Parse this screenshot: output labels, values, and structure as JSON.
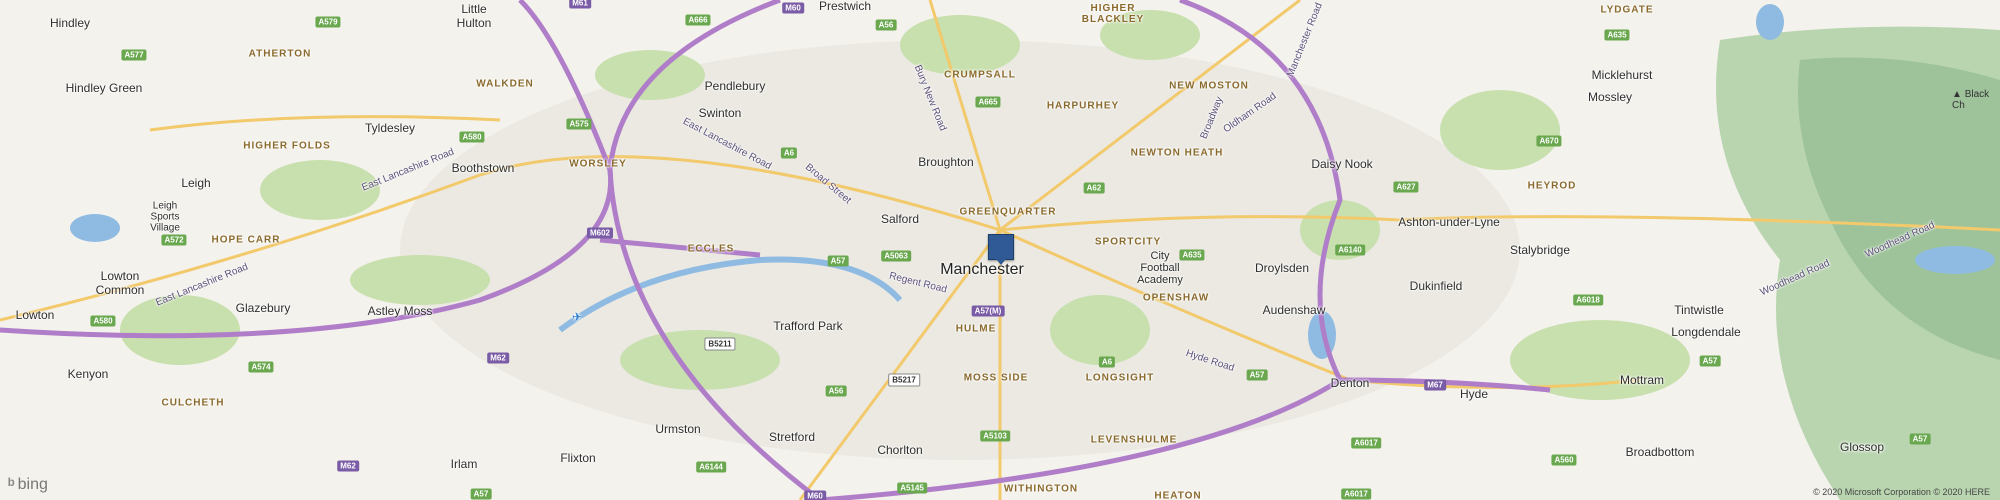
{
  "map": {
    "provider": "bing",
    "copyright": "© 2020 Microsoft Corporation © 2020 HERE",
    "center_label": "Manchester",
    "pin_icon": "location-pin-icon",
    "colors": {
      "motorway": "#b07ec9",
      "primary_road": "#f2c96b",
      "water": "#6fa8dc",
      "park": "#c8dfae",
      "urban": "#ecebe5",
      "hills": "#9cc49a",
      "pin": "#2f5a96"
    },
    "places": [
      {
        "id": "hindley",
        "name": "Hindley"
      },
      {
        "id": "little-hulton",
        "name": "Little\nHulton"
      },
      {
        "id": "hindley-green",
        "name": "Hindley Green"
      },
      {
        "id": "tyldesley",
        "name": "Tyldesley"
      },
      {
        "id": "boothstown",
        "name": "Boothstown"
      },
      {
        "id": "leigh",
        "name": "Leigh"
      },
      {
        "id": "leigh-sports-village",
        "name": "Leigh\nSports\nVillage"
      },
      {
        "id": "lowton-common",
        "name": "Lowton\nCommon"
      },
      {
        "id": "lowton",
        "name": "Lowton"
      },
      {
        "id": "glazebury",
        "name": "Glazebury"
      },
      {
        "id": "astley-moss",
        "name": "Astley Moss"
      },
      {
        "id": "kenyon",
        "name": "Kenyon"
      },
      {
        "id": "irlam",
        "name": "Irlam"
      },
      {
        "id": "flixton",
        "name": "Flixton"
      },
      {
        "id": "urmston",
        "name": "Urmston"
      },
      {
        "id": "stretford",
        "name": "Stretford"
      },
      {
        "id": "chorlton",
        "name": "Chorlton"
      },
      {
        "id": "trafford-park",
        "name": "Trafford Park"
      },
      {
        "id": "pendlebury",
        "name": "Pendlebury"
      },
      {
        "id": "swinton",
        "name": "Swinton"
      },
      {
        "id": "prestwich",
        "name": "Prestwich"
      },
      {
        "id": "broughton",
        "name": "Broughton"
      },
      {
        "id": "salford",
        "name": "Salford"
      },
      {
        "id": "manchester",
        "name": "Manchester"
      },
      {
        "id": "city-football-academy",
        "name": "City\nFootball\nAcademy"
      },
      {
        "id": "daisy-nook",
        "name": "Daisy Nook"
      },
      {
        "id": "droylsden",
        "name": "Droylsden"
      },
      {
        "id": "audenshaw",
        "name": "Audenshaw"
      },
      {
        "id": "denton",
        "name": "Denton"
      },
      {
        "id": "hyde",
        "name": "Hyde"
      },
      {
        "id": "dukinfield",
        "name": "Dukinfield"
      },
      {
        "id": "ashton-under-lyne",
        "name": "Ashton-under-Lyne"
      },
      {
        "id": "stalybridge",
        "name": "Stalybridge"
      },
      {
        "id": "mossley",
        "name": "Mossley"
      },
      {
        "id": "micklehurst",
        "name": "Micklehurst"
      },
      {
        "id": "tintwistle",
        "name": "Tintwistle"
      },
      {
        "id": "longdendale",
        "name": "Longdendale"
      },
      {
        "id": "mottram",
        "name": "Mottram"
      },
      {
        "id": "broadbottom",
        "name": "Broadbottom"
      },
      {
        "id": "glossop",
        "name": "Glossop"
      }
    ],
    "districts": [
      {
        "id": "atherton",
        "name": "ATHERTON"
      },
      {
        "id": "walkden",
        "name": "WALKDEN"
      },
      {
        "id": "higher-folds",
        "name": "HIGHER FOLDS"
      },
      {
        "id": "worsley",
        "name": "WORSLEY"
      },
      {
        "id": "hope-carr",
        "name": "HOPE CARR"
      },
      {
        "id": "eccles",
        "name": "ECCLES"
      },
      {
        "id": "culcheth",
        "name": "CULCHETH"
      },
      {
        "id": "crumpsall",
        "name": "CRUMPSALL"
      },
      {
        "id": "higher-blackley",
        "name": "HIGHER\nBLACKLEY"
      },
      {
        "id": "harpurhey",
        "name": "HARPURHEY"
      },
      {
        "id": "new-moston",
        "name": "NEW MOSTON"
      },
      {
        "id": "newton-heath",
        "name": "NEWTON HEATH"
      },
      {
        "id": "greenquarter",
        "name": "GREENQUARTER"
      },
      {
        "id": "sportcity",
        "name": "SPORTCITY"
      },
      {
        "id": "openshaw",
        "name": "OPENSHAW"
      },
      {
        "id": "hulme",
        "name": "HULME"
      },
      {
        "id": "moss-side",
        "name": "MOSS SIDE"
      },
      {
        "id": "longsight",
        "name": "LONGSIGHT"
      },
      {
        "id": "levenshulme",
        "name": "LEVENSHULME"
      },
      {
        "id": "withington",
        "name": "WITHINGTON"
      },
      {
        "id": "heaton",
        "name": "HEATON"
      },
      {
        "id": "lydgate",
        "name": "LYDGATE"
      },
      {
        "id": "heyrod",
        "name": "HEYROD"
      }
    ],
    "road_names": [
      {
        "id": "east-lancashire-road-w",
        "name": "East Lancashire Road"
      },
      {
        "id": "east-lancashire-road-c",
        "name": "East Lancashire Road"
      },
      {
        "id": "east-lancashire-road-e",
        "name": "East Lancashire Road"
      },
      {
        "id": "broad-street",
        "name": "Broad Street"
      },
      {
        "id": "bury-new-road",
        "name": "Bury New Road"
      },
      {
        "id": "broadway",
        "name": "Broadway"
      },
      {
        "id": "oldham-road",
        "name": "Oldham Road"
      },
      {
        "id": "manchester-road",
        "name": "Manchester Road"
      },
      {
        "id": "regent-road",
        "name": "Regent Road"
      },
      {
        "id": "hyde-road",
        "name": "Hyde Road"
      },
      {
        "id": "woodhead-road-1",
        "name": "Woodhead Road"
      },
      {
        "id": "woodhead-road-2",
        "name": "Woodhead Road"
      }
    ],
    "road_shields": [
      {
        "id": "m61",
        "label": "M61",
        "kind": "p"
      },
      {
        "id": "m60-n",
        "label": "M60",
        "kind": "p"
      },
      {
        "id": "a579",
        "label": "A579",
        "kind": "g"
      },
      {
        "id": "a666",
        "label": "A666",
        "kind": "g"
      },
      {
        "id": "a56",
        "label": "A56",
        "kind": "g"
      },
      {
        "id": "a577",
        "label": "A577",
        "kind": "g"
      },
      {
        "id": "a580",
        "label": "A580",
        "kind": "g"
      },
      {
        "id": "a575",
        "label": "A575",
        "kind": "g"
      },
      {
        "id": "a6",
        "label": "A6",
        "kind": "g"
      },
      {
        "id": "a665",
        "label": "A665",
        "kind": "g"
      },
      {
        "id": "a572",
        "label": "A572",
        "kind": "g"
      },
      {
        "id": "m602",
        "label": "M602",
        "kind": "p"
      },
      {
        "id": "a57-w",
        "label": "A57",
        "kind": "g"
      },
      {
        "id": "a5063",
        "label": "A5063",
        "kind": "g"
      },
      {
        "id": "a57m",
        "label": "A57(M)",
        "kind": "p"
      },
      {
        "id": "a62",
        "label": "A62",
        "kind": "g"
      },
      {
        "id": "a635",
        "label": "A635",
        "kind": "g"
      },
      {
        "id": "a6140",
        "label": "A6140",
        "kind": "g"
      },
      {
        "id": "a627",
        "label": "A627",
        "kind": "g"
      },
      {
        "id": "a670",
        "label": "A670",
        "kind": "g"
      },
      {
        "id": "a6018",
        "label": "A6018",
        "kind": "g"
      },
      {
        "id": "a580-s",
        "label": "A580",
        "kind": "g"
      },
      {
        "id": "a574",
        "label": "A574",
        "kind": "g"
      },
      {
        "id": "b5211",
        "label": "B5211",
        "kind": "w"
      },
      {
        "id": "a56-s",
        "label": "A56",
        "kind": "g"
      },
      {
        "id": "b5217",
        "label": "B5217",
        "kind": "w"
      },
      {
        "id": "a6-s",
        "label": "A6",
        "kind": "g"
      },
      {
        "id": "a57-e",
        "label": "A57",
        "kind": "g"
      },
      {
        "id": "m67",
        "label": "M67",
        "kind": "p"
      },
      {
        "id": "a5103",
        "label": "A5103",
        "kind": "g"
      },
      {
        "id": "a6017",
        "label": "A6017",
        "kind": "g"
      },
      {
        "id": "a560",
        "label": "A560",
        "kind": "g"
      },
      {
        "id": "m62",
        "label": "M62",
        "kind": "p"
      },
      {
        "id": "a57-sw",
        "label": "A57",
        "kind": "g"
      },
      {
        "id": "a6144",
        "label": "A6144",
        "kind": "g"
      },
      {
        "id": "a5145",
        "label": "A5145",
        "kind": "g"
      },
      {
        "id": "m60-s",
        "label": "M60",
        "kind": "p"
      },
      {
        "id": "a6017-s",
        "label": "A6017",
        "kind": "g"
      },
      {
        "id": "a57-ee",
        "label": "A57",
        "kind": "g"
      },
      {
        "id": "a57-far",
        "label": "A57",
        "kind": "g"
      },
      {
        "id": "a635-n",
        "label": "A635",
        "kind": "g"
      },
      {
        "id": "m62-w",
        "label": "M62",
        "kind": "p"
      }
    ],
    "peak_label": "Black Ch"
  }
}
